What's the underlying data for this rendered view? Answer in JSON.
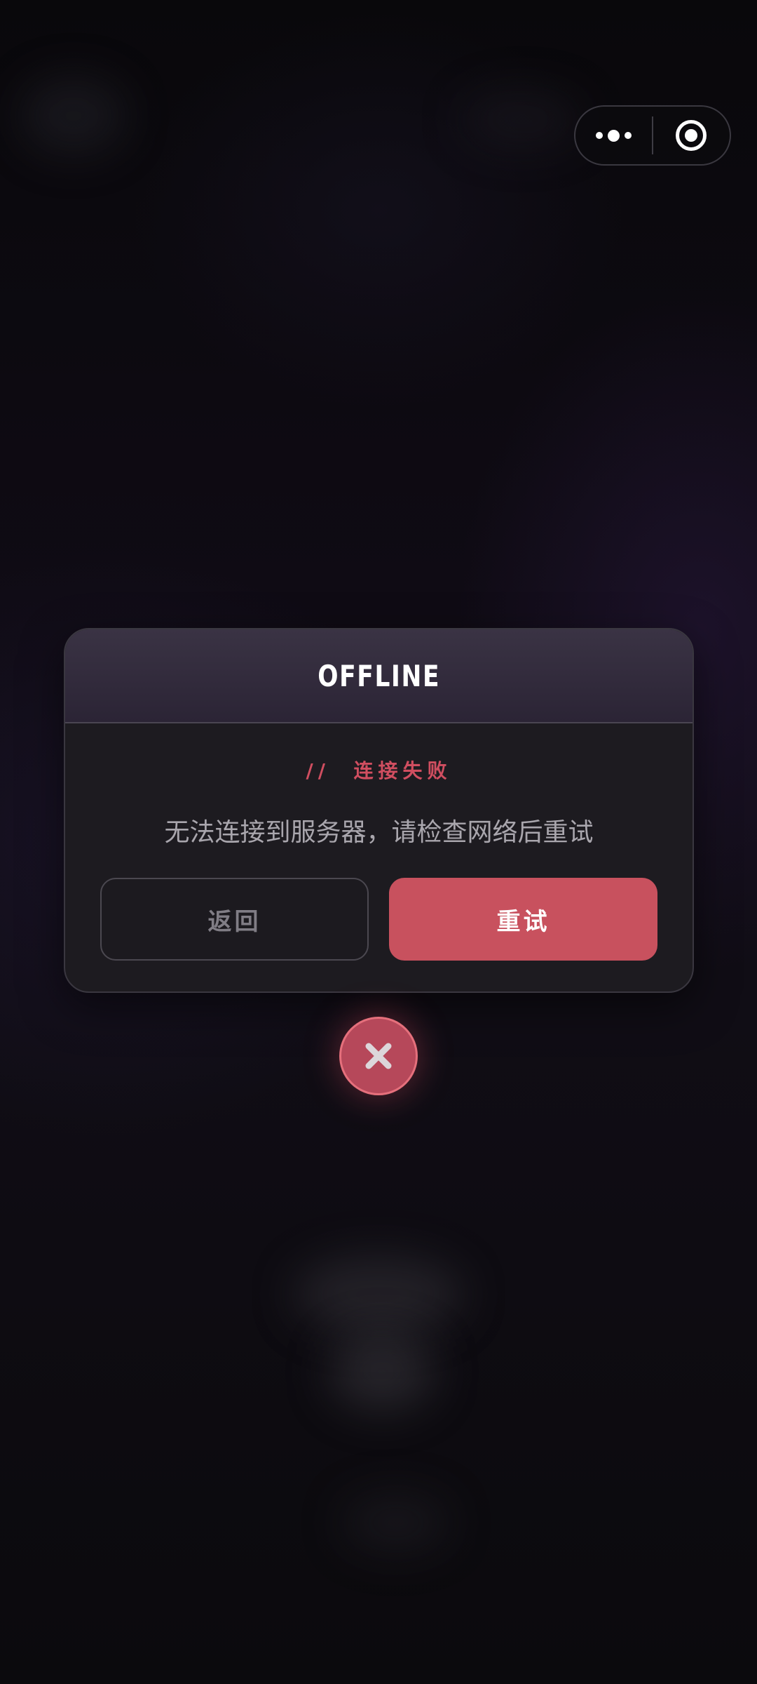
{
  "capsule": {
    "more_icon": "more-dots-icon",
    "home_icon": "target-circle-icon"
  },
  "dialog": {
    "title": "OFFLINE",
    "subtitle": "//  连接失败",
    "message": "无法连接到服务器，请检查网络后重试",
    "buttons": {
      "back_label": "返回",
      "retry_label": "重试"
    }
  },
  "close_button": {
    "icon": "close-icon"
  },
  "colors": {
    "accent_red": "#c8515e",
    "subtitle_red": "#d04e60",
    "header_purple": "#2b2435",
    "dialog_bg": "#1d1b20"
  }
}
